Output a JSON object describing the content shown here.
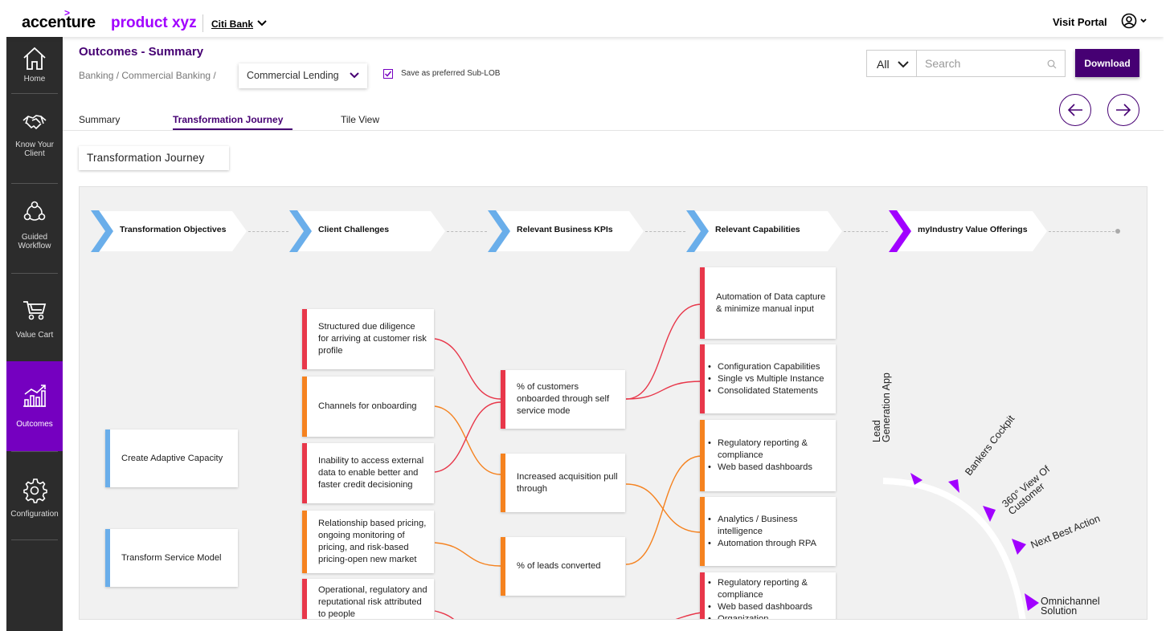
{
  "topbar": {
    "logo": "accenture",
    "logo_mark": ">",
    "product": "product xyz",
    "client": "Citi Bank",
    "visit_portal": "Visit Portal"
  },
  "sidebar": {
    "items": [
      {
        "label": "Home"
      },
      {
        "label": "Know Your Client"
      },
      {
        "label": "Guided Workflow"
      },
      {
        "label": "Value Cart"
      },
      {
        "label": "Outcomes"
      },
      {
        "label": "Configuration"
      }
    ],
    "active": "Outcomes"
  },
  "header": {
    "title": "Outcomes - Summary",
    "breadcrumb": "Banking / Commercial Banking /",
    "sub_lob": "Commercial Lending",
    "preferred_label": "Save as preferred Sub-LOB",
    "preferred_checked": true,
    "filter_value": "All",
    "search_placeholder": "Search",
    "download_label": "Download"
  },
  "tabs": [
    {
      "label": "Summary",
      "active": false
    },
    {
      "label": "Transformation Journey",
      "active": true
    },
    {
      "label": "Tile View",
      "active": false
    }
  ],
  "section_title": "Transformation Journey",
  "journey": {
    "stages": [
      "Transformation Objectives",
      "Client Challenges",
      "Relevant Business KPIs",
      "Relevant Capabilities",
      "myIndustry Value Offerings"
    ],
    "objectives": [
      "Create Adaptive Capacity",
      "Transform Service Model"
    ],
    "challenges": [
      {
        "text": "Structured due diligence for arriving at customer risk profile",
        "color": "#e8374a"
      },
      {
        "text": "Channels for onboarding",
        "color": "#f5821f"
      },
      {
        "text": "Inability to access external data to enable better and faster credit decisioning",
        "color": "#e8374a"
      },
      {
        "text": "Relationship based pricing, ongoing monitoring of pricing, and risk-based pricing-open new market",
        "color": "#f5821f"
      },
      {
        "text": "Operational, regulatory and reputational risk attributed to people",
        "color": "#e8374a"
      }
    ],
    "kpis": [
      {
        "text": "% of customers onboarded through self service mode",
        "color": "#e8374a"
      },
      {
        "text": "Increased acquisition pull through",
        "color": "#f5821f"
      },
      {
        "text": "% of leads converted",
        "color": "#f5821f"
      }
    ],
    "capabilities": [
      {
        "text": "Automation of Data capture & minimize manual input",
        "items": [],
        "color": "#e8374a"
      },
      {
        "text": "",
        "items": [
          "Configuration Capabilities",
          "Single vs Multiple Instance",
          "Consolidated Statements"
        ],
        "color": "#e8374a"
      },
      {
        "text": "",
        "items": [
          "Regulatory reporting & compliance",
          "Web based dashboards"
        ],
        "color": "#f5821f"
      },
      {
        "text": "",
        "items": [
          "Analytics / Business intelligence",
          "Automation through RPA"
        ],
        "color": "#f5821f"
      },
      {
        "text": "",
        "items": [
          "Regulatory reporting & compliance",
          "Web based dashboards",
          "Organization"
        ],
        "color": "#e8374a"
      }
    ],
    "offerings": [
      {
        "line1": "Lead",
        "line2": "Generation App"
      },
      {
        "line1": "Bankers Cockpit",
        "line2": ""
      },
      {
        "line1": "360° View Of",
        "line2": "Customer"
      },
      {
        "line1": "Next Best Action",
        "line2": ""
      },
      {
        "line1": "Omnichannel",
        "line2": "Solution"
      }
    ]
  },
  "colors": {
    "brand": "#a100ff",
    "primary_dark": "#460073",
    "sidebar_bg": "#2c2c2c",
    "sidebar_active": "#7500c0",
    "chevron_blue": "#6aaeea",
    "chevron_purple": "#a100ff",
    "red": "#e8374a",
    "orange": "#f5821f"
  }
}
